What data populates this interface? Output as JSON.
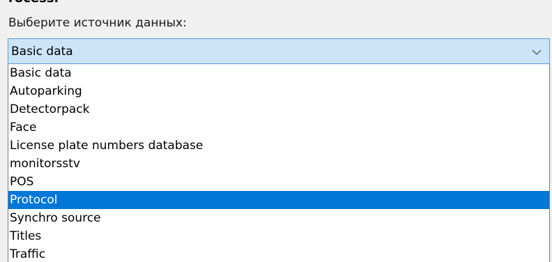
{
  "top_fragment": "rocess.",
  "prompt_label": "Выберите источник данных:",
  "combo": {
    "selected_value": "Basic data",
    "arrow_icon": "chevron-down-icon"
  },
  "options": [
    {
      "label": "Basic data",
      "selected": false
    },
    {
      "label": "Autoparking",
      "selected": false
    },
    {
      "label": "Detectorpack",
      "selected": false
    },
    {
      "label": "Face",
      "selected": false
    },
    {
      "label": "License plate numbers database",
      "selected": false
    },
    {
      "label": "monitorsstv",
      "selected": false
    },
    {
      "label": "POS",
      "selected": false
    },
    {
      "label": "Protocol",
      "selected": true
    },
    {
      "label": "Synchro source",
      "selected": false
    },
    {
      "label": "Titles",
      "selected": false
    },
    {
      "label": "Traffic",
      "selected": false
    }
  ],
  "colors": {
    "combo_background": "#cce4f7",
    "combo_border": "#5b9bd5",
    "highlight": "#0078d7",
    "highlight_text": "#ffffff"
  }
}
